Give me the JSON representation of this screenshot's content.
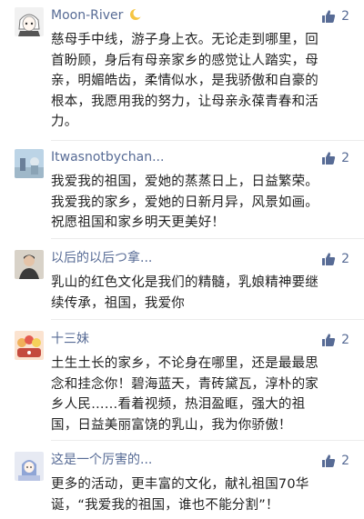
{
  "colors": {
    "username": "#576b95",
    "content_text": "#222222",
    "like_icon": "#576b95",
    "divider": "#ececec",
    "background": "#ffffff"
  },
  "comments": [
    {
      "username": "Moon-River",
      "username_emoji_icon": "crescent-moon-icon",
      "avatar_icon": "anime-character-avatar",
      "likes": "2",
      "content": "慈母手中线，游子身上衣。无论走到哪里，回\n首盼顾，身后有母亲家乡的感觉让人踏实，母\n亲，明媚皓齿，柔情似水，是我骄傲和自豪的\n根本，我愿用我的努力，让母亲永葆青春和活\n力。"
    },
    {
      "username": "Itwasnotbychan...",
      "avatar_icon": "outdoor-photo-avatar",
      "likes": "2",
      "content": "我爱我的祖国，爱她的蒸蒸日上，日益繁荣。\n我爱我的家乡，爱她的日新月异，风景如画。\n祝愿祖国和家乡明天更美好！"
    },
    {
      "username": "以后的以后つ拿...",
      "avatar_icon": "person-photo-avatar",
      "likes": "2",
      "content": "乳山的红色文化是我们的精髓，乳娘精神要继\n续传承，祖国，我爱你"
    },
    {
      "username": "十三妹",
      "avatar_icon": "cartoon-group-avatar",
      "likes": "2",
      "content": "土生土长的家乡，不论身在哪里，还是最最思\n念和挂念你！碧海蓝天，青砖黛瓦，淳朴的家\n乡人民……看着视频，热泪盈眶，强大的祖\n国，日益美丽富饶的乳山，我为你骄傲！"
    },
    {
      "username": "这是一个厉害的...",
      "avatar_icon": "character-illustration-avatar",
      "likes": "2",
      "content": "更多的活动，更丰富的文化，献礼祖国70华\n诞，“我爱我的祖国，谁也不能分割”！"
    }
  ]
}
